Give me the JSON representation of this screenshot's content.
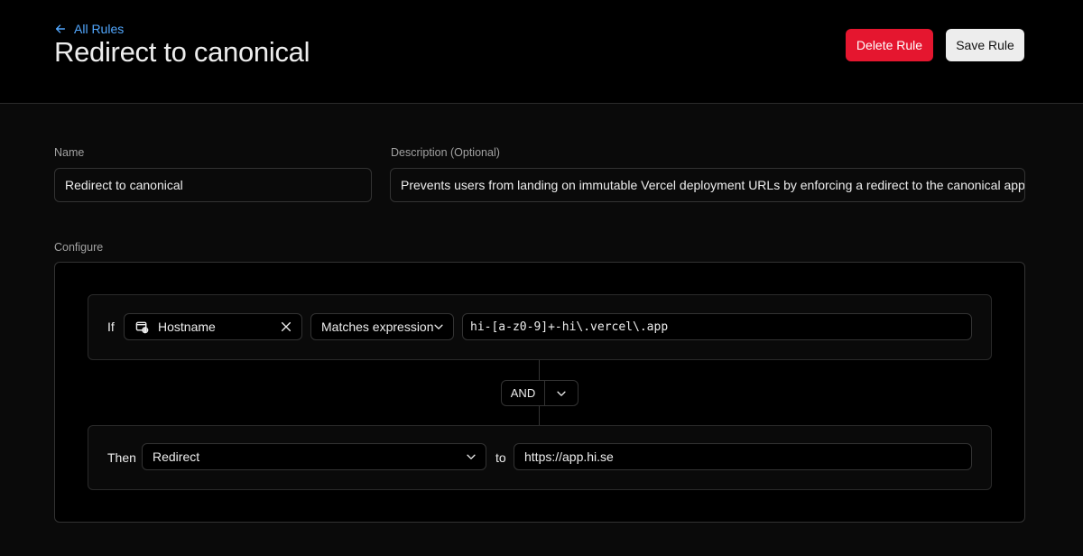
{
  "header": {
    "back_label": "All Rules",
    "title": "Redirect to canonical",
    "delete_label": "Delete Rule",
    "save_label": "Save Rule"
  },
  "form": {
    "name_label": "Name",
    "name_value": "Redirect to canonical",
    "description_label": "Description (Optional)",
    "description_value": "Prevents users from landing on immutable Vercel deployment URLs by enforcing a redirect to the canonical application",
    "configure_label": "Configure"
  },
  "condition": {
    "if_label": "If",
    "field_value": "Hostname",
    "field_icon": "hostname-icon",
    "operator_value": "Matches expression",
    "expression_value": "hi-[a-z0-9]+-hi\\.vercel\\.app",
    "combinator": "AND"
  },
  "action": {
    "then_label": "Then",
    "action_value": "Redirect",
    "to_label": "to",
    "destination_value": "https://app.hi.se"
  },
  "colors": {
    "accent_link": "#52a8ff",
    "danger": "#e5162f",
    "background": "#0a0a0a"
  }
}
